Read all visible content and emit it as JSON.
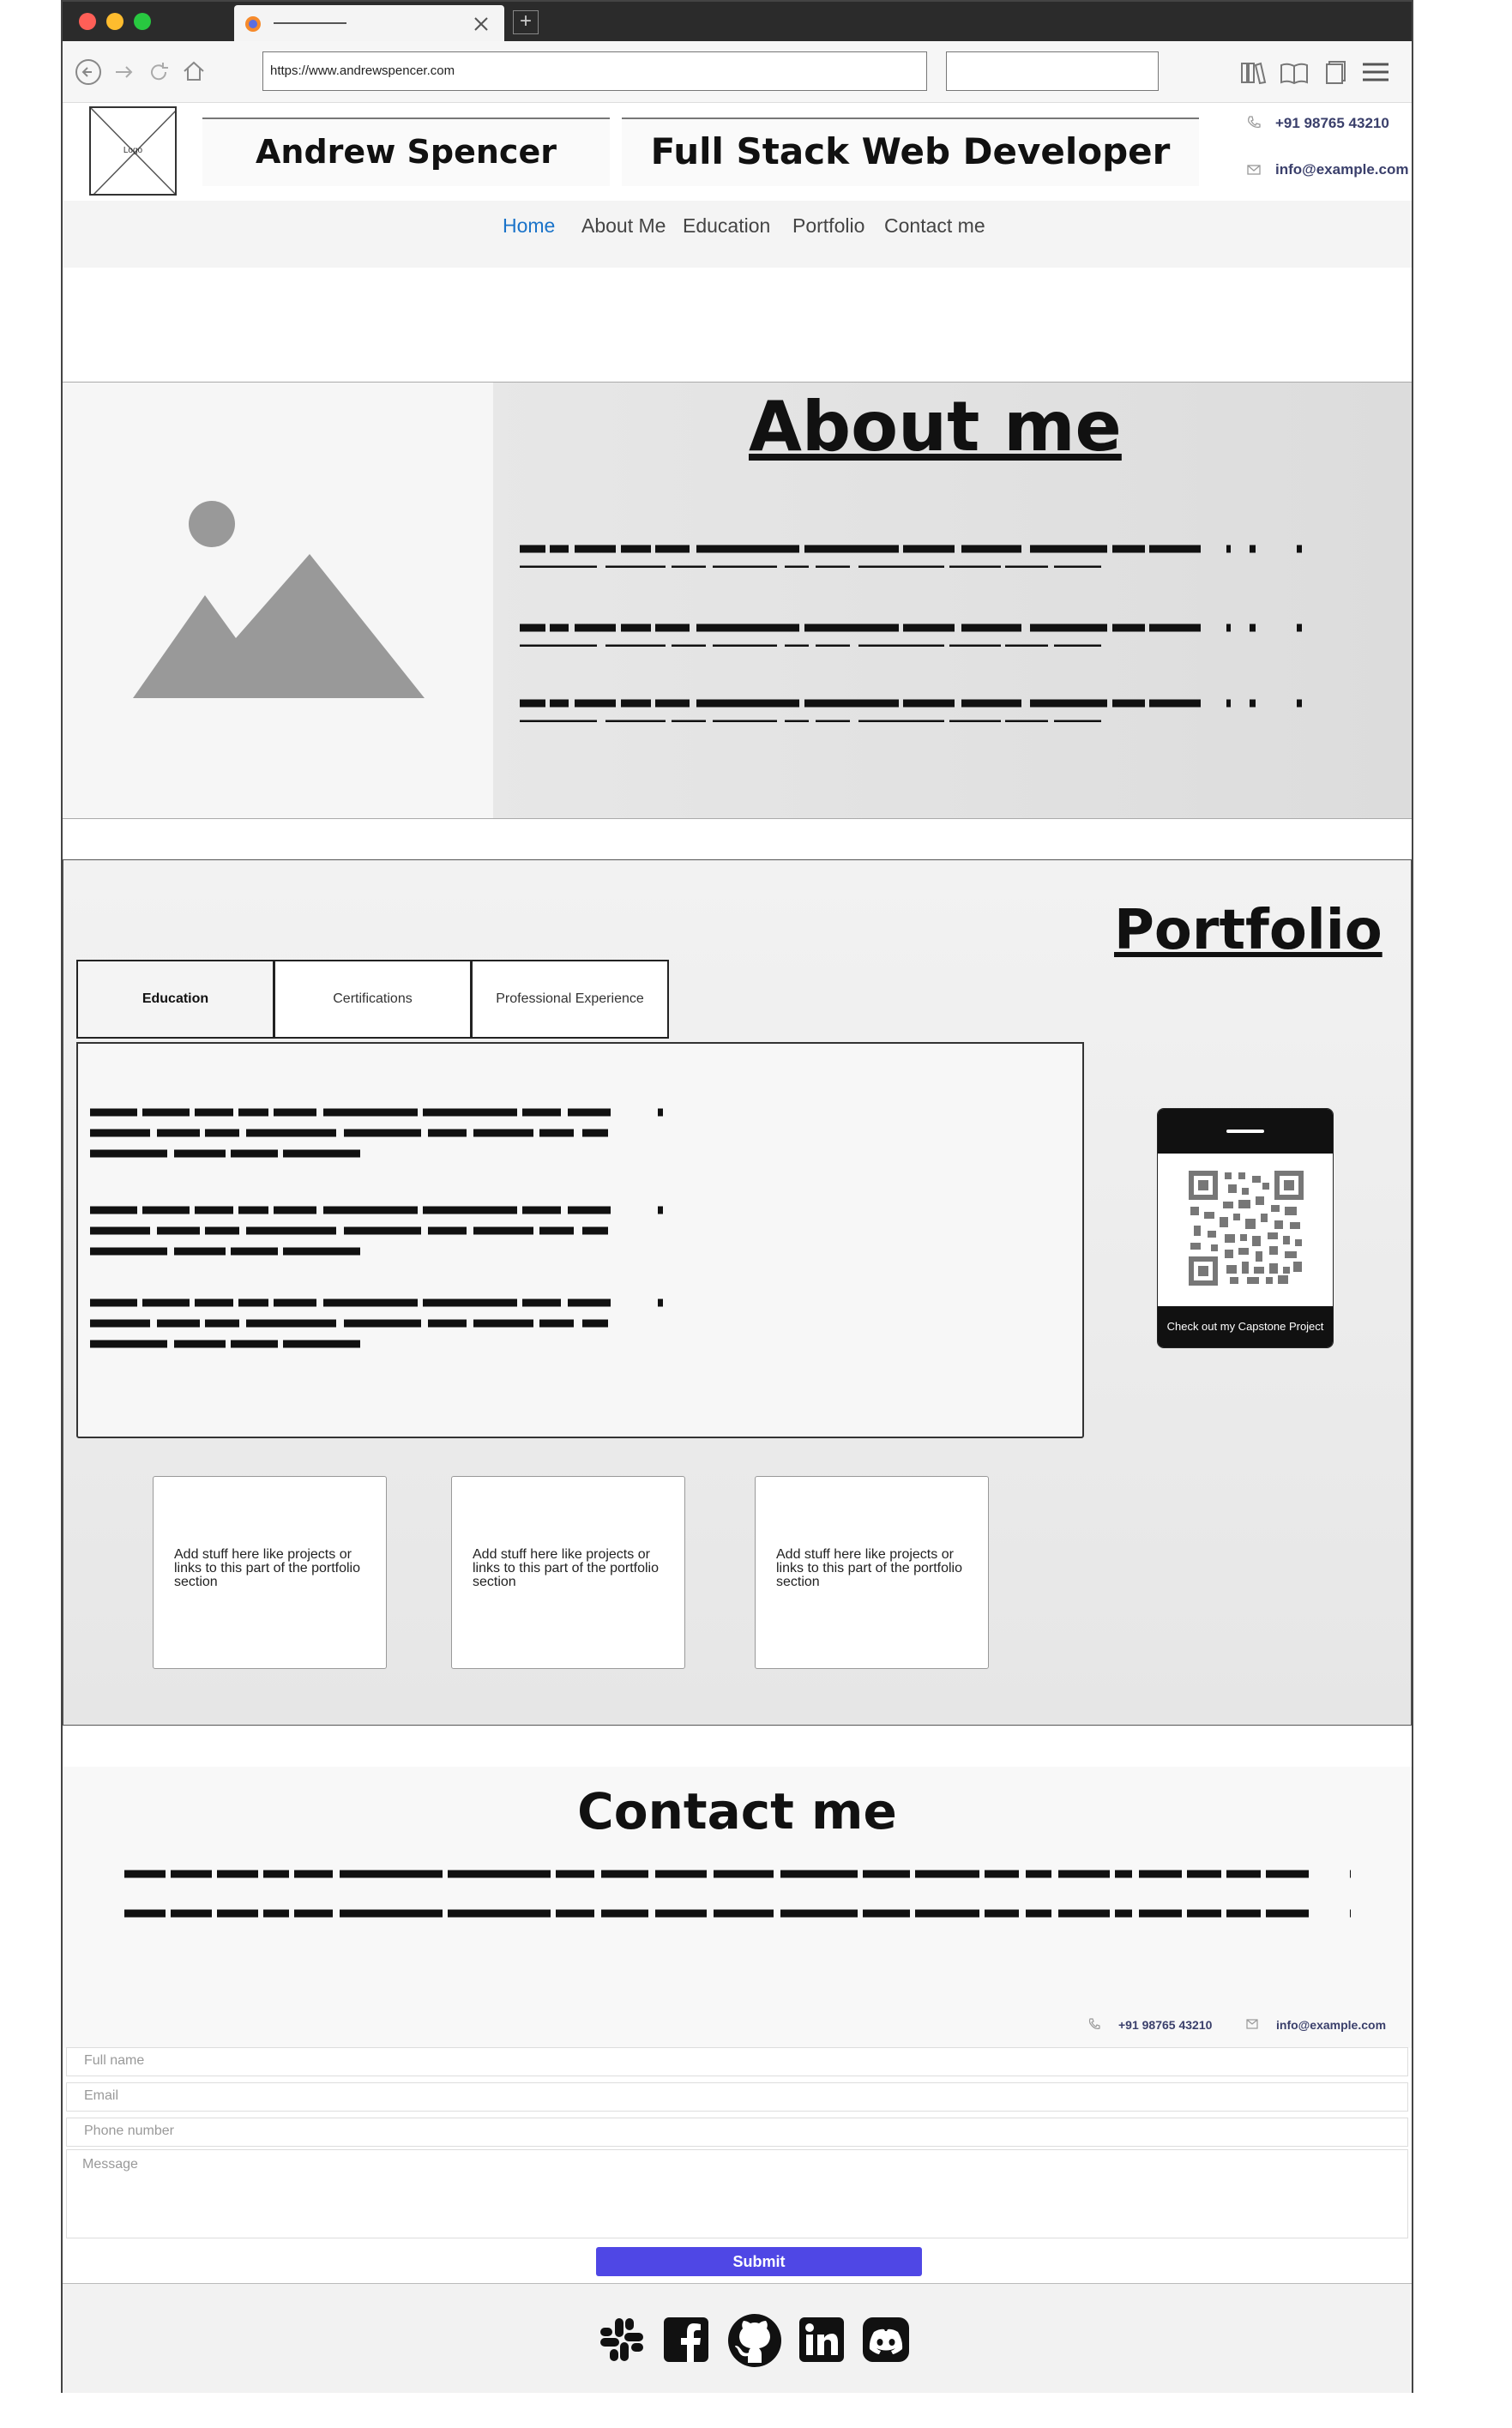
{
  "browser": {
    "tab_title": "",
    "url": "https://www.andrewspencer.com",
    "search_value": ""
  },
  "header": {
    "logo_text": "Logo",
    "name": "Andrew Spencer",
    "role": "Full Stack Web Developer",
    "phone": "+91 98765 43210",
    "email": "info@example.com"
  },
  "nav": {
    "items": [
      {
        "label": "Home",
        "active": true
      },
      {
        "label": "About Me",
        "active": false
      },
      {
        "label": "Education",
        "active": false
      },
      {
        "label": "Portfolio",
        "active": false
      },
      {
        "label": "Contact me",
        "active": false
      }
    ],
    "active_color": "#1a73c9"
  },
  "about": {
    "title": "About me",
    "image_icon": "image-placeholder-icon"
  },
  "portfolio": {
    "title": "Portfolio",
    "tabs": [
      "Education",
      "Certifications",
      "Professional Experience"
    ],
    "active_tab": "Education",
    "qr_caption": "Check out my Capstone Project",
    "cards": [
      "Add stuff here like projects or links  to this part of the portfolio section",
      "Add stuff here like projects or links  to this part of the portfolio section",
      "Add stuff here like projects or links  to this part of the portfolio section"
    ]
  },
  "contact": {
    "title": "Contact me",
    "phone": "+91 98765 43210",
    "email": "info@example.com",
    "form": {
      "full_name_placeholder": "Full name",
      "email_placeholder": "Email",
      "phone_placeholder": "Phone number",
      "message_placeholder": "Message",
      "submit_label": "Submit"
    },
    "submit_color": "#4f47e5"
  },
  "footer": {
    "social_icons": [
      "slack-icon",
      "facebook-icon",
      "github-icon",
      "linkedin-icon",
      "discord-icon"
    ]
  }
}
